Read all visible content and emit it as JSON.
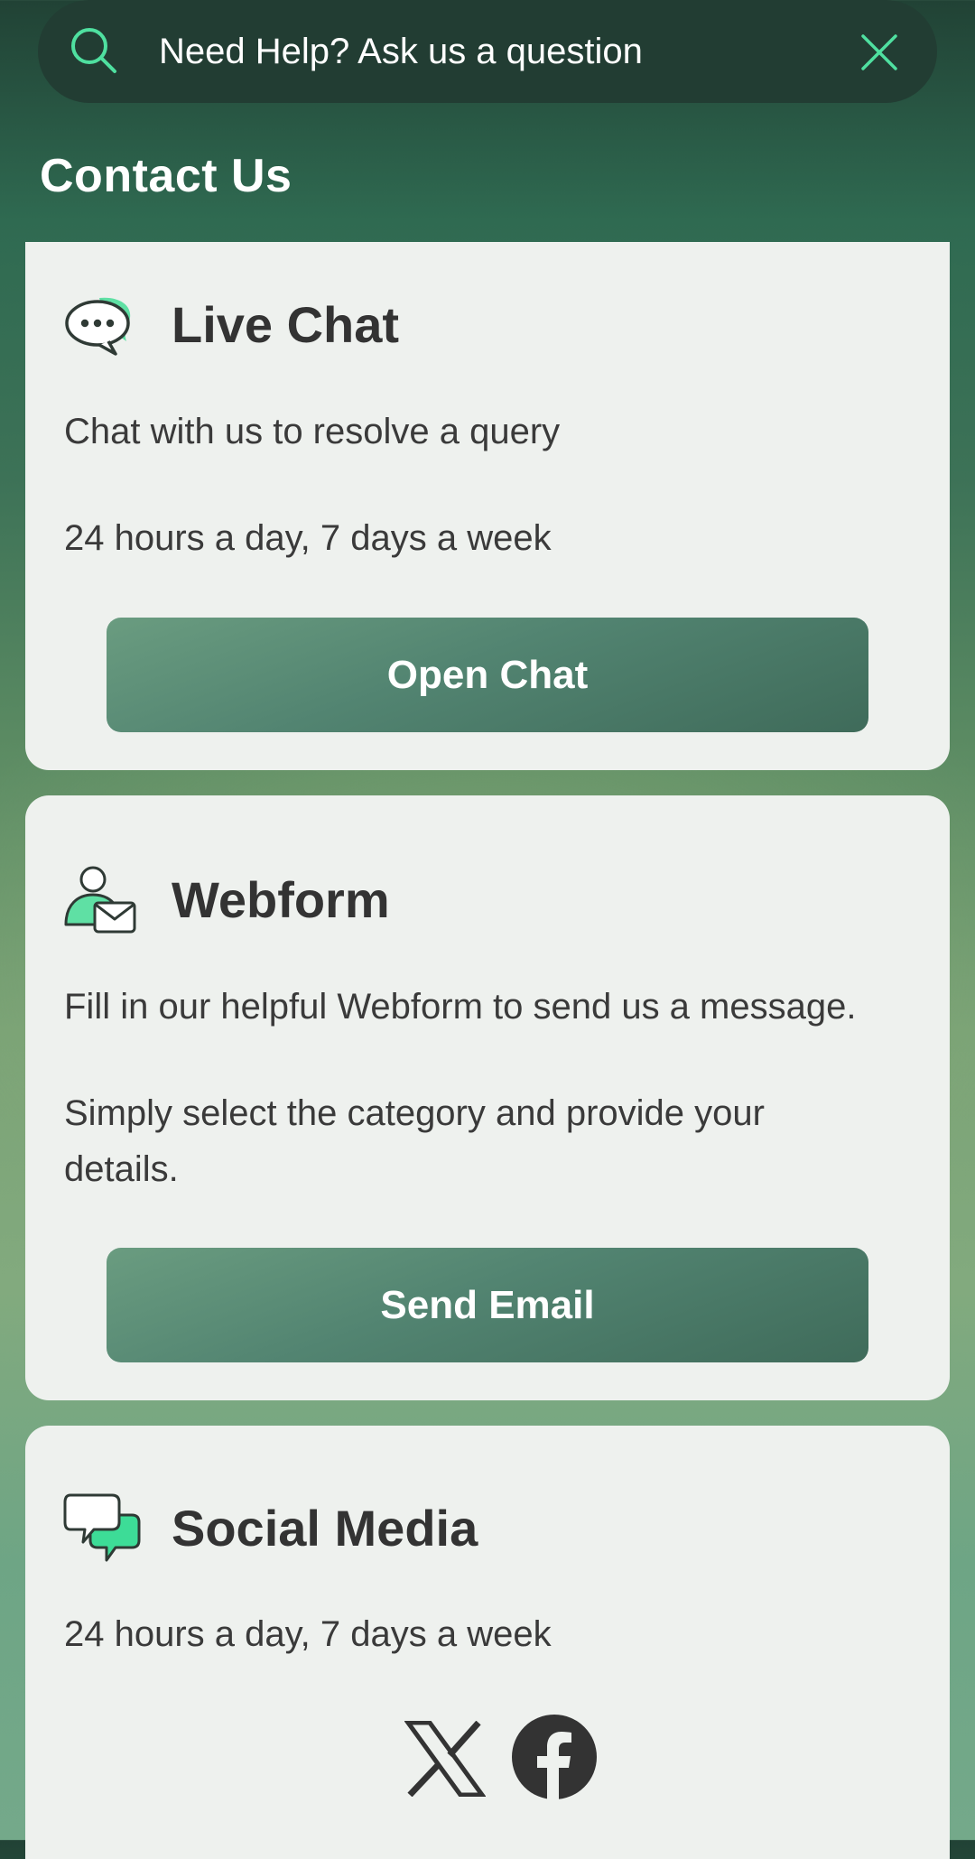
{
  "search": {
    "placeholder": "Need Help? Ask us a question",
    "search_icon": "search-icon",
    "close_icon": "close-icon"
  },
  "page": {
    "title": "Contact Us"
  },
  "colors": {
    "accent_green": "#3ddc97",
    "card_background": "#eef1ee",
    "button_gradient_start": "#6a9c80",
    "button_gradient_end": "#3f6b5a",
    "search_bar": "#223d33"
  },
  "cards": {
    "live_chat": {
      "icon": "chat-bubbles-icon",
      "title": "Live Chat",
      "line1": "Chat with us to resolve a query",
      "line2": "24 hours a day, 7 days a week",
      "button_label": "Open Chat"
    },
    "webform": {
      "icon": "user-mail-icon",
      "title": "Webform",
      "line1": "Fill in our helpful Webform to send us a message.",
      "line2": "Simply select the category and provide your details.",
      "button_label": "Send Email"
    },
    "social_media": {
      "icon": "speech-bubbles-icon",
      "title": "Social Media",
      "line1": "24 hours a day, 7 days a week",
      "links": [
        "x-icon",
        "facebook-icon"
      ]
    }
  }
}
